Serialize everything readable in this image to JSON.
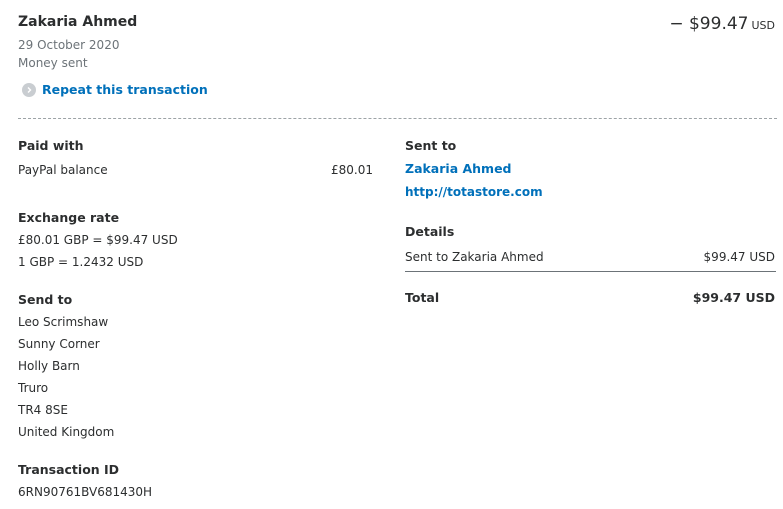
{
  "header": {
    "name": "Zakaria Ahmed",
    "date": "29 October 2020",
    "status": "Money sent",
    "repeat_label": "Repeat this transaction",
    "amount": "− $99.47",
    "amount_currency": "USD"
  },
  "paid_with": {
    "label": "Paid with",
    "method": "PayPal balance",
    "amount": "£80.01"
  },
  "exchange_rate": {
    "label": "Exchange rate",
    "line1": "£80.01 GBP = $99.47 USD",
    "line2": "1 GBP = 1.2432 USD"
  },
  "send_to": {
    "label": "Send to",
    "address": [
      "Leo Scrimshaw",
      "Sunny Corner",
      "Holly Barn",
      "Truro",
      "TR4 8SE",
      "United Kingdom"
    ]
  },
  "transaction": {
    "label": "Transaction ID",
    "id": "6RN90761BV681430H"
  },
  "sent_to": {
    "label": "Sent to",
    "name": "Zakaria Ahmed",
    "url": "http://totastore.com"
  },
  "details": {
    "label": "Details",
    "line_label": "Sent to Zakaria Ahmed",
    "line_amount": "$99.47 USD",
    "total_label": "Total",
    "total_amount": "$99.47 USD"
  },
  "colors": {
    "link": "#0070ba",
    "text": "#2c2e2f",
    "muted": "#6c7378"
  }
}
